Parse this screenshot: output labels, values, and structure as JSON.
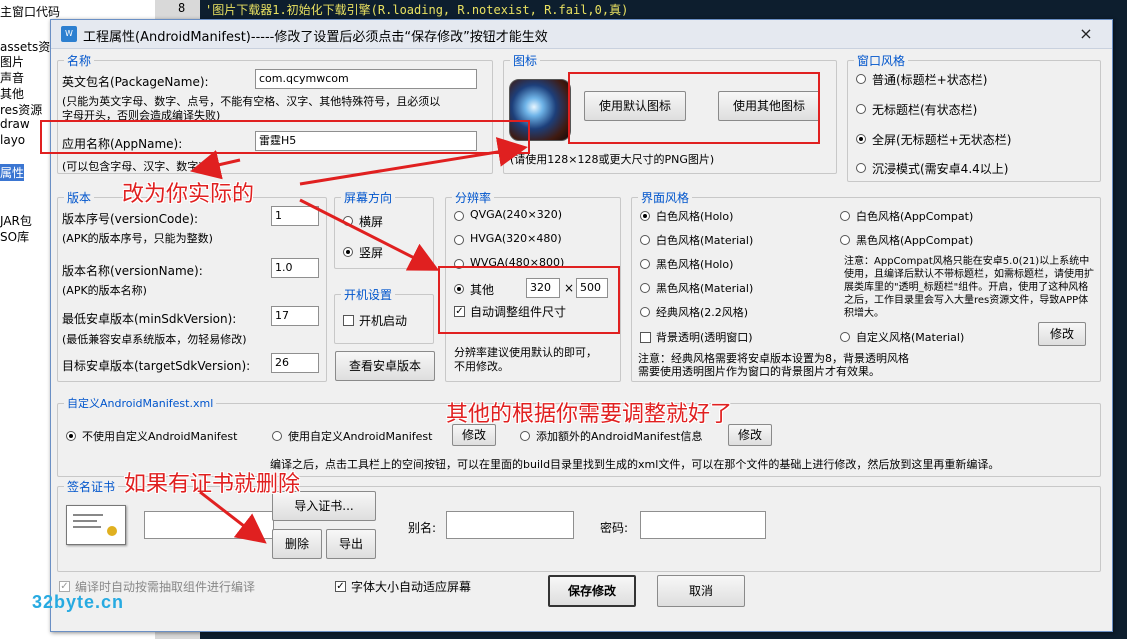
{
  "background": {
    "tree_items": [
      {
        "label": "主窗口代码",
        "selected": false
      },
      {
        "label": "assets资",
        "selected": false
      },
      {
        "label": "图片",
        "selected": false
      },
      {
        "label": "声音",
        "selected": false
      },
      {
        "label": "其他",
        "selected": false
      },
      {
        "label": "res资源",
        "selected": false
      },
      {
        "label": "draw",
        "selected": false
      },
      {
        "label": "layo",
        "selected": false
      },
      {
        "label": "属性",
        "selected": true
      },
      {
        "label": "JAR包",
        "selected": false
      },
      {
        "label": "SO库",
        "selected": false
      }
    ],
    "line_number": "8",
    "code_line": "'图片下载器1.初始化下载引擎(R.loading, R.notexist, R.fail,0,真)",
    "watermark": "32byte.cn"
  },
  "dialog": {
    "title": "工程属性(AndroidManifest)-----修改了设置后必须点击“保存修改”按钮才能生效",
    "close_glyph": "×",
    "name_group": {
      "legend": "名称",
      "package_label": "英文包名(PackageName):",
      "package_value": "com.qcymwcom",
      "package_hint_1": "(只能为英文字母、数字、点号，不能有空格、汉字、其他特殊符号，且必须以",
      "package_hint_2": "字母开头，否则会造成编译失败)",
      "app_label": "应用名称(AppName):",
      "app_value": "雷霆H5",
      "app_hint": "(可以包含字母、汉字、数字)"
    },
    "icon_group": {
      "legend": "图标",
      "default_btn": "使用默认图标",
      "other_btn": "使用其他图标",
      "hint": "(请使用128×128或更大尺寸的PNG图片)"
    },
    "window_style": {
      "legend": "窗口风格",
      "options": [
        {
          "label": "普通(标题栏+状态栏)",
          "checked": false
        },
        {
          "label": "无标题栏(有状态栏)",
          "checked": false
        },
        {
          "label": "全屏(无标题栏+无状态栏)",
          "checked": true
        },
        {
          "label": "沉浸模式(需安卓4.4以上)",
          "checked": false
        }
      ]
    },
    "version_group": {
      "legend": "版本",
      "code_label": "版本序号(versionCode):",
      "code_value": "1",
      "code_hint": "(APK的版本序号，只能为整数)",
      "name_label": "版本名称(versionName):",
      "name_value": "1.0",
      "name_hint": "(APK的版本名称)",
      "min_label": "最低安卓版本(minSdkVersion):",
      "min_value": "17",
      "min_hint": "(最低兼容安卓系统版本，勿轻易修改)",
      "target_label": "目标安卓版本(targetSdkVersion):",
      "target_value": "26"
    },
    "orientation": {
      "legend": "屏幕方向",
      "options": [
        {
          "label": "横屏",
          "checked": false
        },
        {
          "label": "竖屏",
          "checked": true
        }
      ]
    },
    "boot": {
      "legend": "开机设置",
      "auto_label": "开机启动",
      "auto_checked": false
    },
    "view_android_btn": "查看安卓版本",
    "resolution": {
      "legend": "分辨率",
      "options": [
        {
          "label": "QVGA(240×320)",
          "checked": false
        },
        {
          "label": "HVGA(320×480)",
          "checked": false
        },
        {
          "label": "WVGA(480×800)",
          "checked": false
        },
        {
          "label": "其他",
          "checked": true
        }
      ],
      "width": "320",
      "times": "×",
      "height": "500",
      "auto_adjust_label": "自动调整组件尺寸",
      "auto_adjust_checked": true,
      "hint_1": "分辨率建议使用默认的即可，",
      "hint_2": "不用修改。"
    },
    "ui_style": {
      "legend": "界面风格",
      "left_options": [
        {
          "label": "白色风格(Holo)",
          "checked": true
        },
        {
          "label": "白色风格(Material)",
          "checked": false
        },
        {
          "label": "黑色风格(Holo)",
          "checked": false
        },
        {
          "label": "黑色风格(Material)",
          "checked": false
        },
        {
          "label": "经典风格(2.2风格)",
          "checked": false
        }
      ],
      "right_options": [
        {
          "label": "白色风格(AppCompat)",
          "checked": false
        },
        {
          "label": "黑色风格(AppCompat)",
          "checked": false
        }
      ],
      "note": "注意：AppCompat风格只能在安卓5.0(21)以上系统中使用，且编译后默认不带标题栏，如需标题栏，请使用扩展类库里的\"透明_标题栏\"组件。开启，使用了这种风格之后，工作目录里会写入大量res资源文件，导致APP体积增大。",
      "transparent_label": "背景透明(透明窗口)",
      "custom_label": "自定义风格(Material)",
      "modify_btn": "修改",
      "bottom_note_1": "注意：经典风格需要将安卓版本设置为8，背景透明风格",
      "bottom_note_2": "需要使用透明图片作为窗口的背景图片才有效果。"
    },
    "manifest": {
      "legend": "自定义AndroidManifest.xml",
      "no_custom": "不使用自定义AndroidManifest",
      "use_custom": "使用自定义AndroidManifest",
      "modify_1": "修改",
      "add_extra": "添加额外的AndroidManifest信息",
      "modify_2": "修改",
      "hint": "编译之后，点击工具栏上的空间按钮，可以在里面的build目录里找到生成的xml文件，可以在那个文件的基础上进行修改，然后放到这里再重新编译。"
    },
    "signature": {
      "legend": "签名证书",
      "import_btn": "导入证书...",
      "delete_btn": "删除",
      "export_btn": "导出",
      "alias_label": "别名:",
      "password_label": "密码:"
    },
    "bottom": {
      "auto_extract_label": "编译时自动按需抽取组件进行编译",
      "font_auto_label": "字体大小自动适应屏幕",
      "save_btn": "保存修改",
      "cancel_btn": "取消"
    }
  },
  "annotations": {
    "change_to_actual": "改为你实际的",
    "adjust_others": "其他的根据你需要调整就好了",
    "delete_cert": "如果有证书就删除",
    "color": "#e02020"
  }
}
